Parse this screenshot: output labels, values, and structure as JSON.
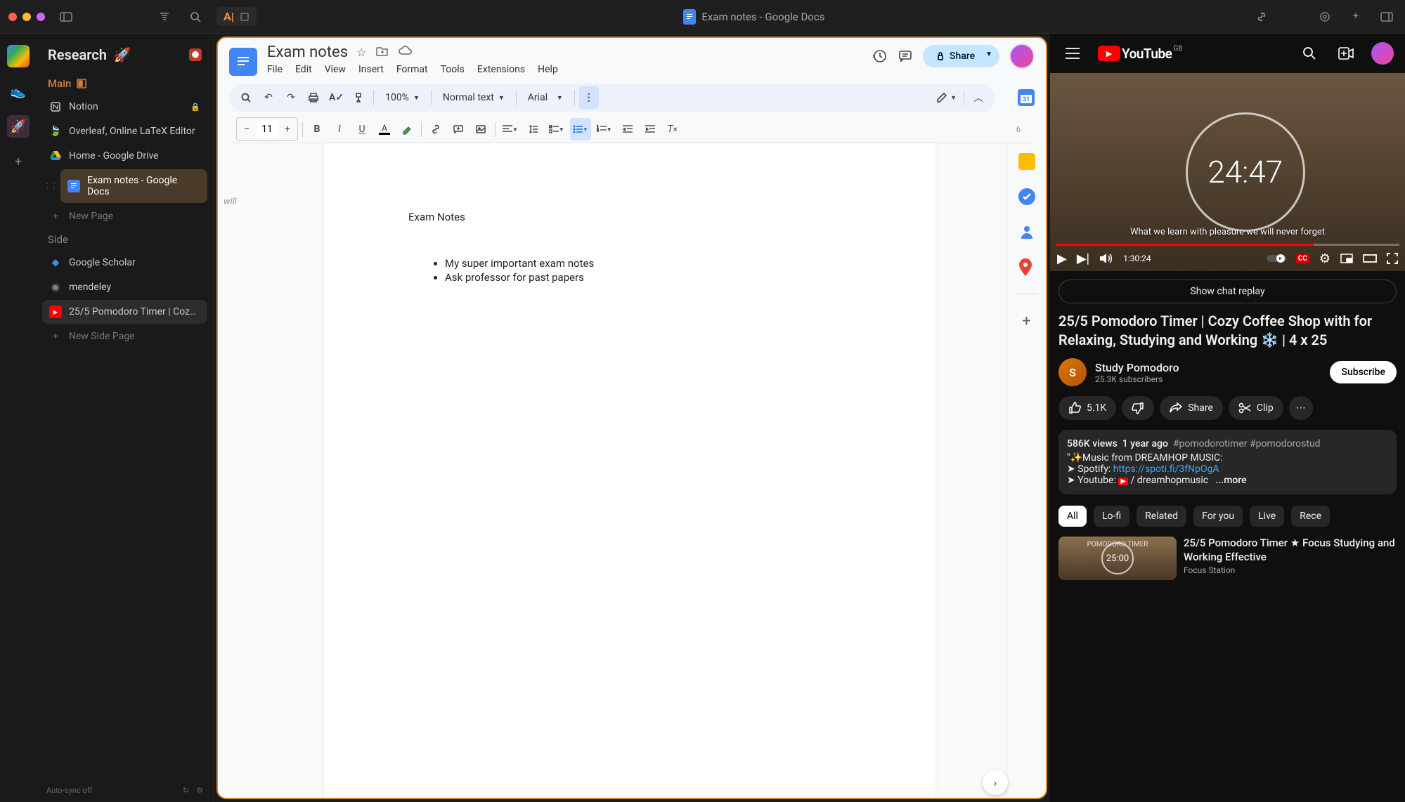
{
  "titlebar": {
    "windowTitle": "Exam notes - Google Docs"
  },
  "sidebar": {
    "workspace": "Research",
    "mainLabel": "Main",
    "items": [
      {
        "icon": "notion",
        "label": "Notion"
      },
      {
        "icon": "overleaf",
        "label": "Overleaf, Online LaTeX Editor"
      },
      {
        "icon": "gdrive",
        "label": "Home - Google Drive"
      },
      {
        "icon": "gdocs",
        "label": "Exam notes - Google Docs",
        "active": true
      }
    ],
    "newPage": "New Page",
    "sideLabel": "Side",
    "sideItems": [
      {
        "icon": "scholar",
        "label": "Google Scholar"
      },
      {
        "icon": "mendeley",
        "label": "mendeley"
      },
      {
        "icon": "youtube",
        "label": "25/5 Pomodoro Timer | Cozy...",
        "active": true
      }
    ],
    "newSidePage": "New Side Page",
    "autoSync": "Auto-sync off"
  },
  "docs": {
    "docTitle": "Exam notes",
    "menus": [
      "File",
      "Edit",
      "View",
      "Insert",
      "Format",
      "Tools",
      "Extensions",
      "Help"
    ],
    "shareLabel": "Share",
    "zoom": "100%",
    "styleSelect": "Normal text",
    "fontSelect": "Arial",
    "fontSize": "11",
    "rulerNote": "will",
    "content": {
      "heading": "Exam Notes",
      "bullets": [
        "My super important exam notes",
        "Ask professor for past papers"
      ]
    }
  },
  "youtube": {
    "logoText": "YouTube",
    "region": "GB",
    "timer": "24:47",
    "quote": "What we learn with pleasure we will never forget",
    "currentTime": "1:30:24",
    "chatReplay": "Show chat replay",
    "videoTitle": "25/5 Pomodoro Timer | Cozy Coffee Shop with for Relaxing, Studying and Working ❄️ | 4 x 25",
    "channelName": "Study Pomodoro",
    "subscribers": "25.3K subscribers",
    "subscribeLabel": "Subscribe",
    "likes": "5.1K",
    "shareLabel": "Share",
    "clipLabel": "Clip",
    "views": "586K views",
    "age": "1 year ago",
    "hashtags": "#pomodorotimer #pomodorostud",
    "descLine1": "\"✨Music from DREAMHOP MUSIC:",
    "descSpotifyPre": "➤ Spotify: ",
    "descSpotifyLink": "https://spoti.fi/3fNpOgA",
    "descYoutubePre": "➤ Youtube:  ",
    "descYoutubeChan": " / dreamhopmusic",
    "moreLabel": "...more",
    "chips": [
      "All",
      "Lo-fi",
      "Related",
      "For you",
      "Live",
      "Rece"
    ],
    "rec": {
      "title": "25/5 Pomodoro Timer ★ Focus Studying and Working Effective",
      "channel": "Focus Station",
      "thumbTimer": "25:00"
    }
  }
}
